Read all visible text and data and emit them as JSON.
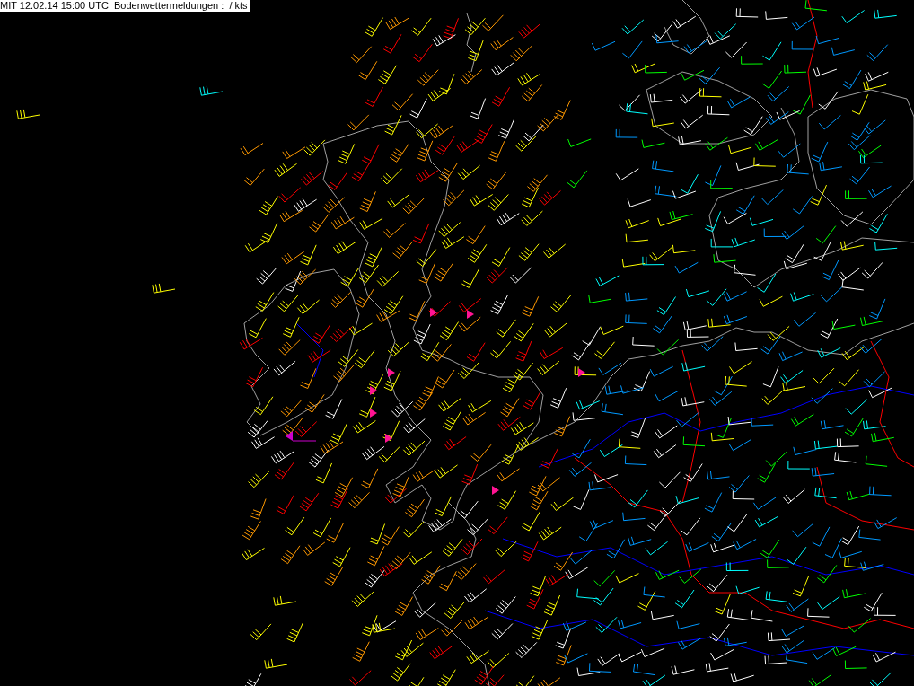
{
  "title_bar": {
    "text": "MIT 12.02.14 15:00 UTC  Bodenwettermeldungen :  / kts"
  }
}
